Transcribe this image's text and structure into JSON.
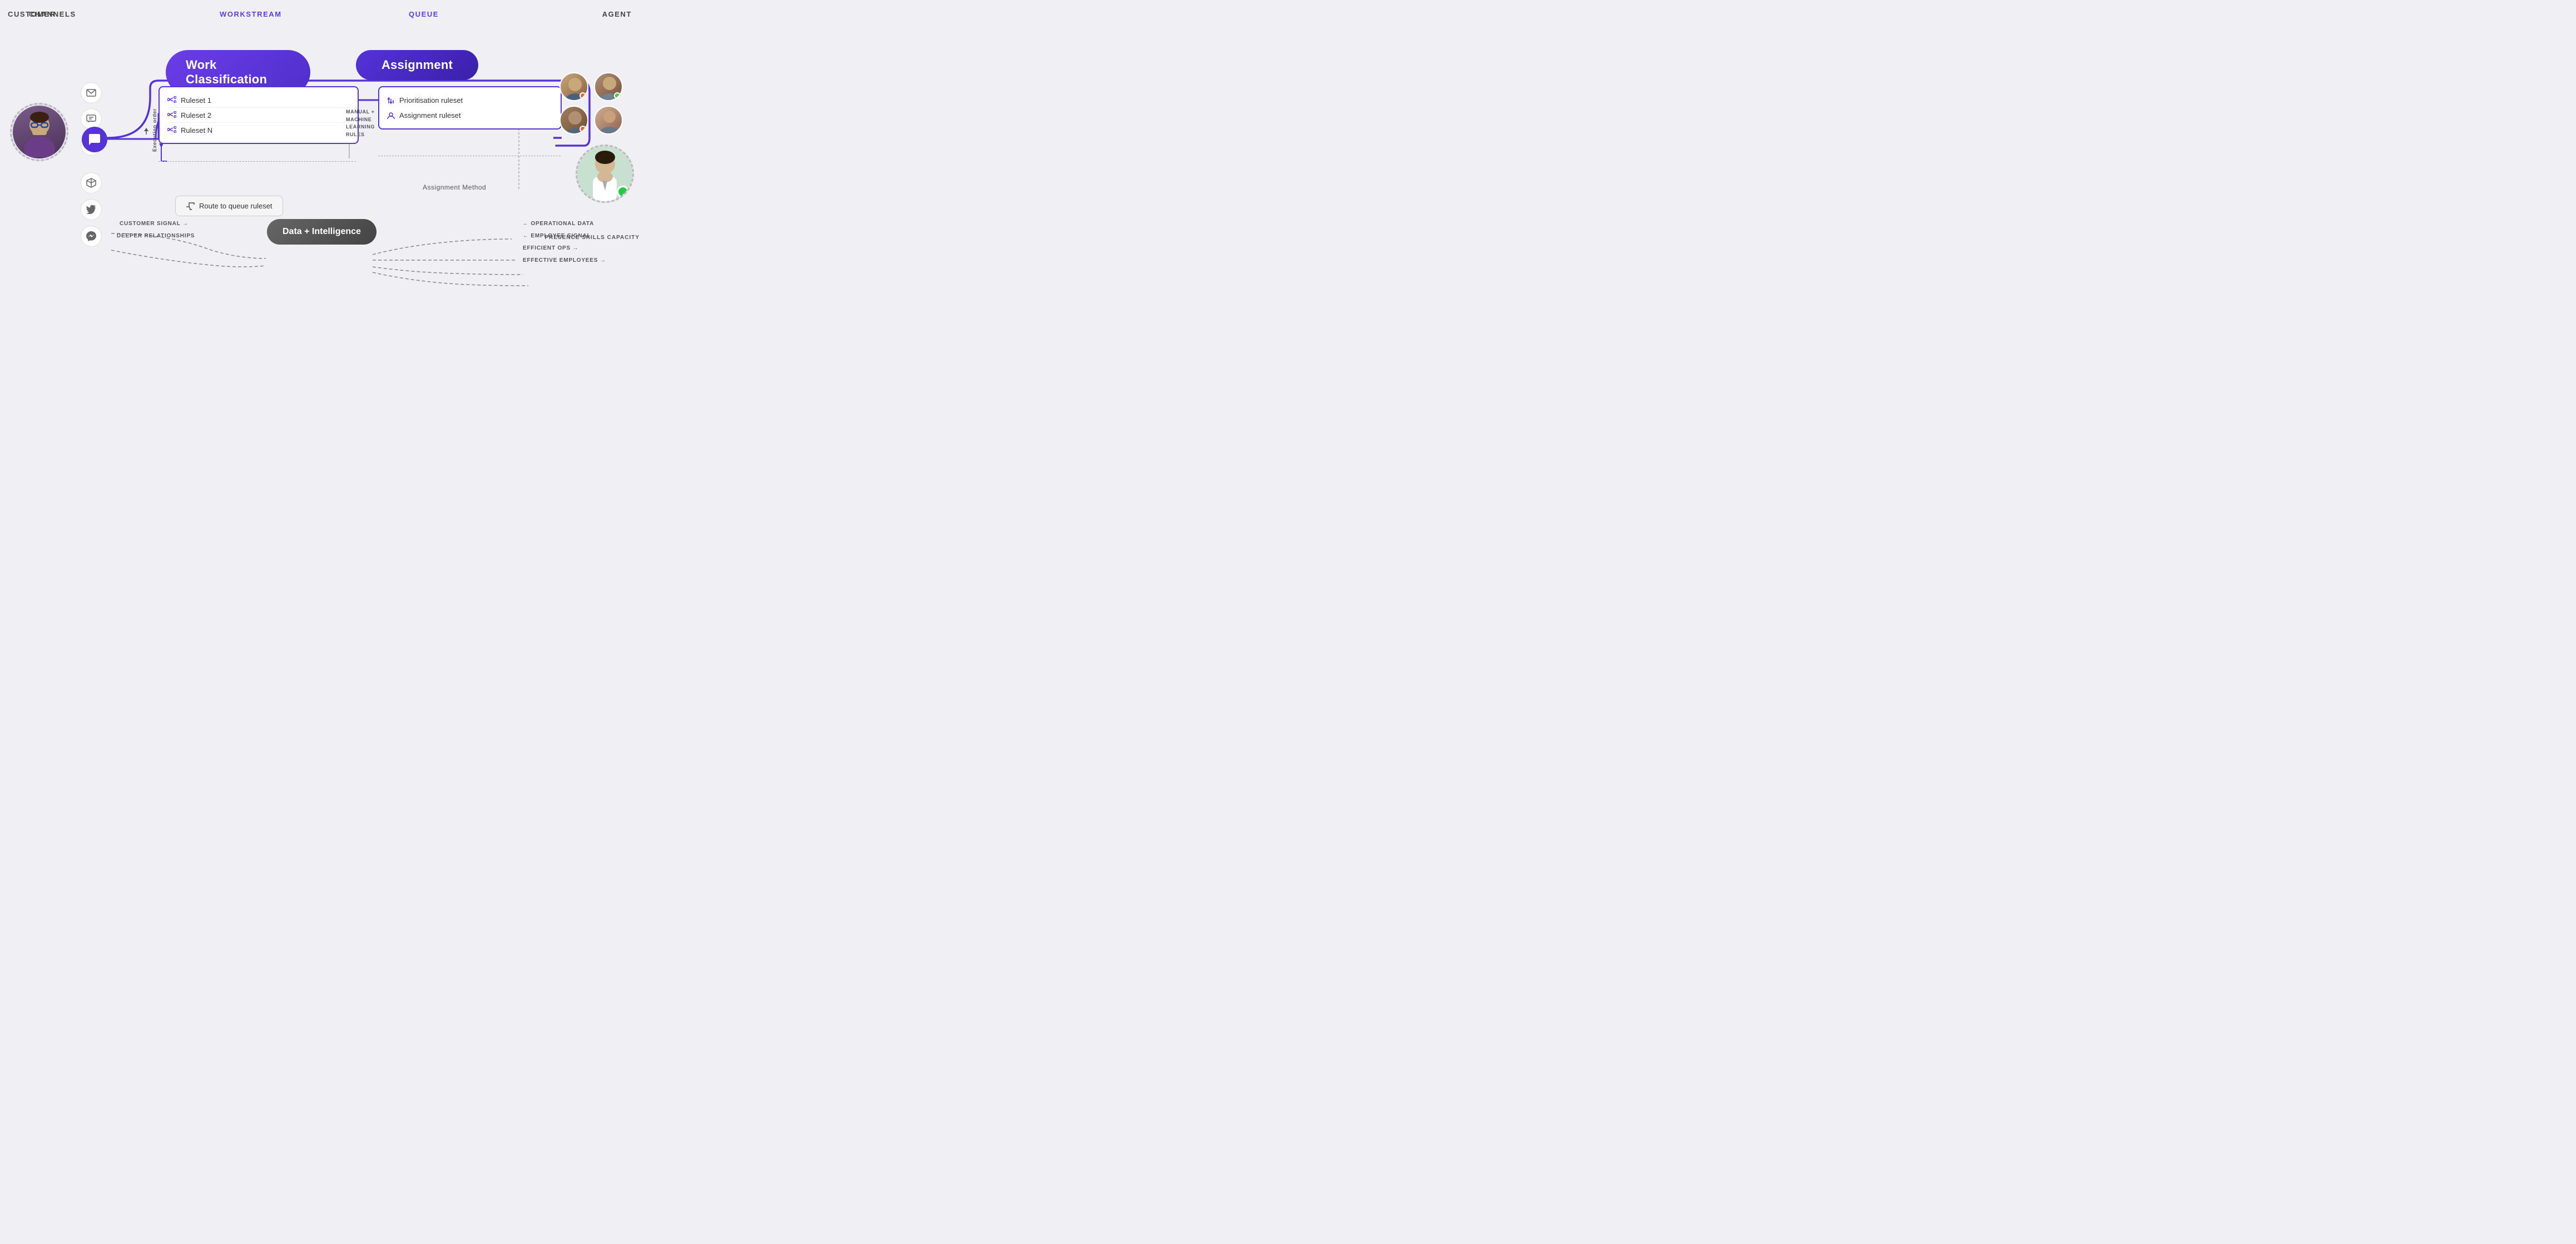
{
  "headers": {
    "customer": "CUSTOMER",
    "channels": "CHANNELS",
    "workstream": "WORKSTREAM",
    "queue": "QUEUE",
    "agent": "AGENT"
  },
  "pills": {
    "work_classification": "Work Classification",
    "assignment": "Assignment"
  },
  "rulesets": [
    {
      "label": "Ruleset 1"
    },
    {
      "label": "Ruleset 2"
    },
    {
      "label": "Ruleset N"
    }
  ],
  "manual_label": "MANUAL +\nMACHINE\nLEARNING\nRULES",
  "route_label": "Route to queue ruleset",
  "execution_label": "Execution order",
  "queue_items": [
    {
      "icon": "sort",
      "label": "Prioritisation ruleset"
    },
    {
      "icon": "person",
      "label": "Assignment ruleset"
    }
  ],
  "assignment_method": "Assignment Method",
  "data_pill": "Data + Intelligence",
  "flow_labels": {
    "customer_signal": "CUSTOMER SIGNAL →",
    "deeper_relationships": "DEEPER RELATIONSHIPS",
    "operational_data": "← OPERATIONAL DATA",
    "employee_signal": "← EMPLOYEE SIGNAL",
    "efficient_ops": "EFFICIENT OPS →",
    "effective_employees": "EFFECTIVE EMPLOYEES →"
  },
  "agent_attrs": "PRESENCE\nSKILLS\nCAPACITY",
  "colors": {
    "primary": "#5533d8",
    "pill_gradient_start": "#6b3de8",
    "pill_gradient_end": "#3a1faa",
    "background": "#f0eff4"
  }
}
